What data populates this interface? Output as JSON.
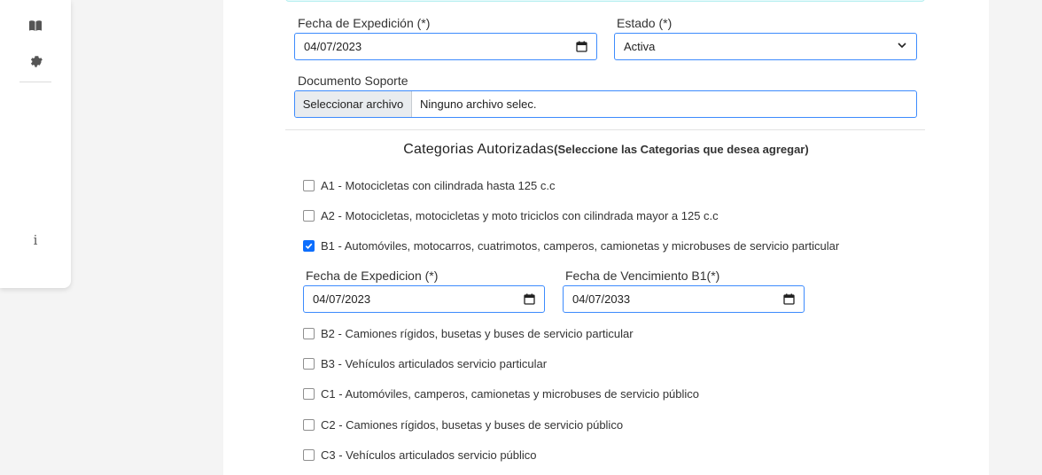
{
  "sidebar": {
    "icons": [
      "book-icon",
      "gear-icon",
      "info-icon"
    ],
    "info_glyph": "i"
  },
  "form": {
    "fecha_expedicion": {
      "label": "Fecha de Expedición (*)",
      "value": "04/07/2023"
    },
    "estado": {
      "label": "Estado (*)",
      "value": "Activa"
    },
    "documento": {
      "label": "Documento Soporte",
      "button": "Seleccionar archivo",
      "status": "Ninguno archivo selec."
    }
  },
  "categories": {
    "title": "Categorias Autorizadas",
    "subtitle": "(Seleccione las Categorias que desea agregar)",
    "items": [
      {
        "label": "A1 - Motocicletas con cilindrada hasta 125 c.c",
        "checked": false
      },
      {
        "label": "A2 - Motocicletas, motocicletas y moto triciclos con cilindrada mayor a 125 c.c",
        "checked": false
      },
      {
        "label": "B1 - Automóviles, motocarros, cuatrimotos, camperos, camionetas y microbuses de servicio particular",
        "checked": true
      },
      {
        "label": "B2 - Camiones rígidos, busetas y buses de servicio particular",
        "checked": false
      },
      {
        "label": "B3 - Vehículos articulados servicio particular",
        "checked": false
      },
      {
        "label": "C1 - Automóviles, camperos, camionetas y microbuses de servicio público",
        "checked": false
      },
      {
        "label": "C2 - Camiones rígidos, busetas y buses de servicio público",
        "checked": false
      },
      {
        "label": "C3 - Vehículos articulados servicio público",
        "checked": false
      }
    ],
    "b1_dates": {
      "expedicion": {
        "label": "Fecha de Expedicion (*)",
        "value": "04/07/2023"
      },
      "vencimiento": {
        "label": "Fecha de Vencimiento B1(*)",
        "value": "04/07/2033"
      }
    }
  },
  "colors": {
    "accent": "#0d6efd",
    "input_border": "#3d8bfd"
  }
}
